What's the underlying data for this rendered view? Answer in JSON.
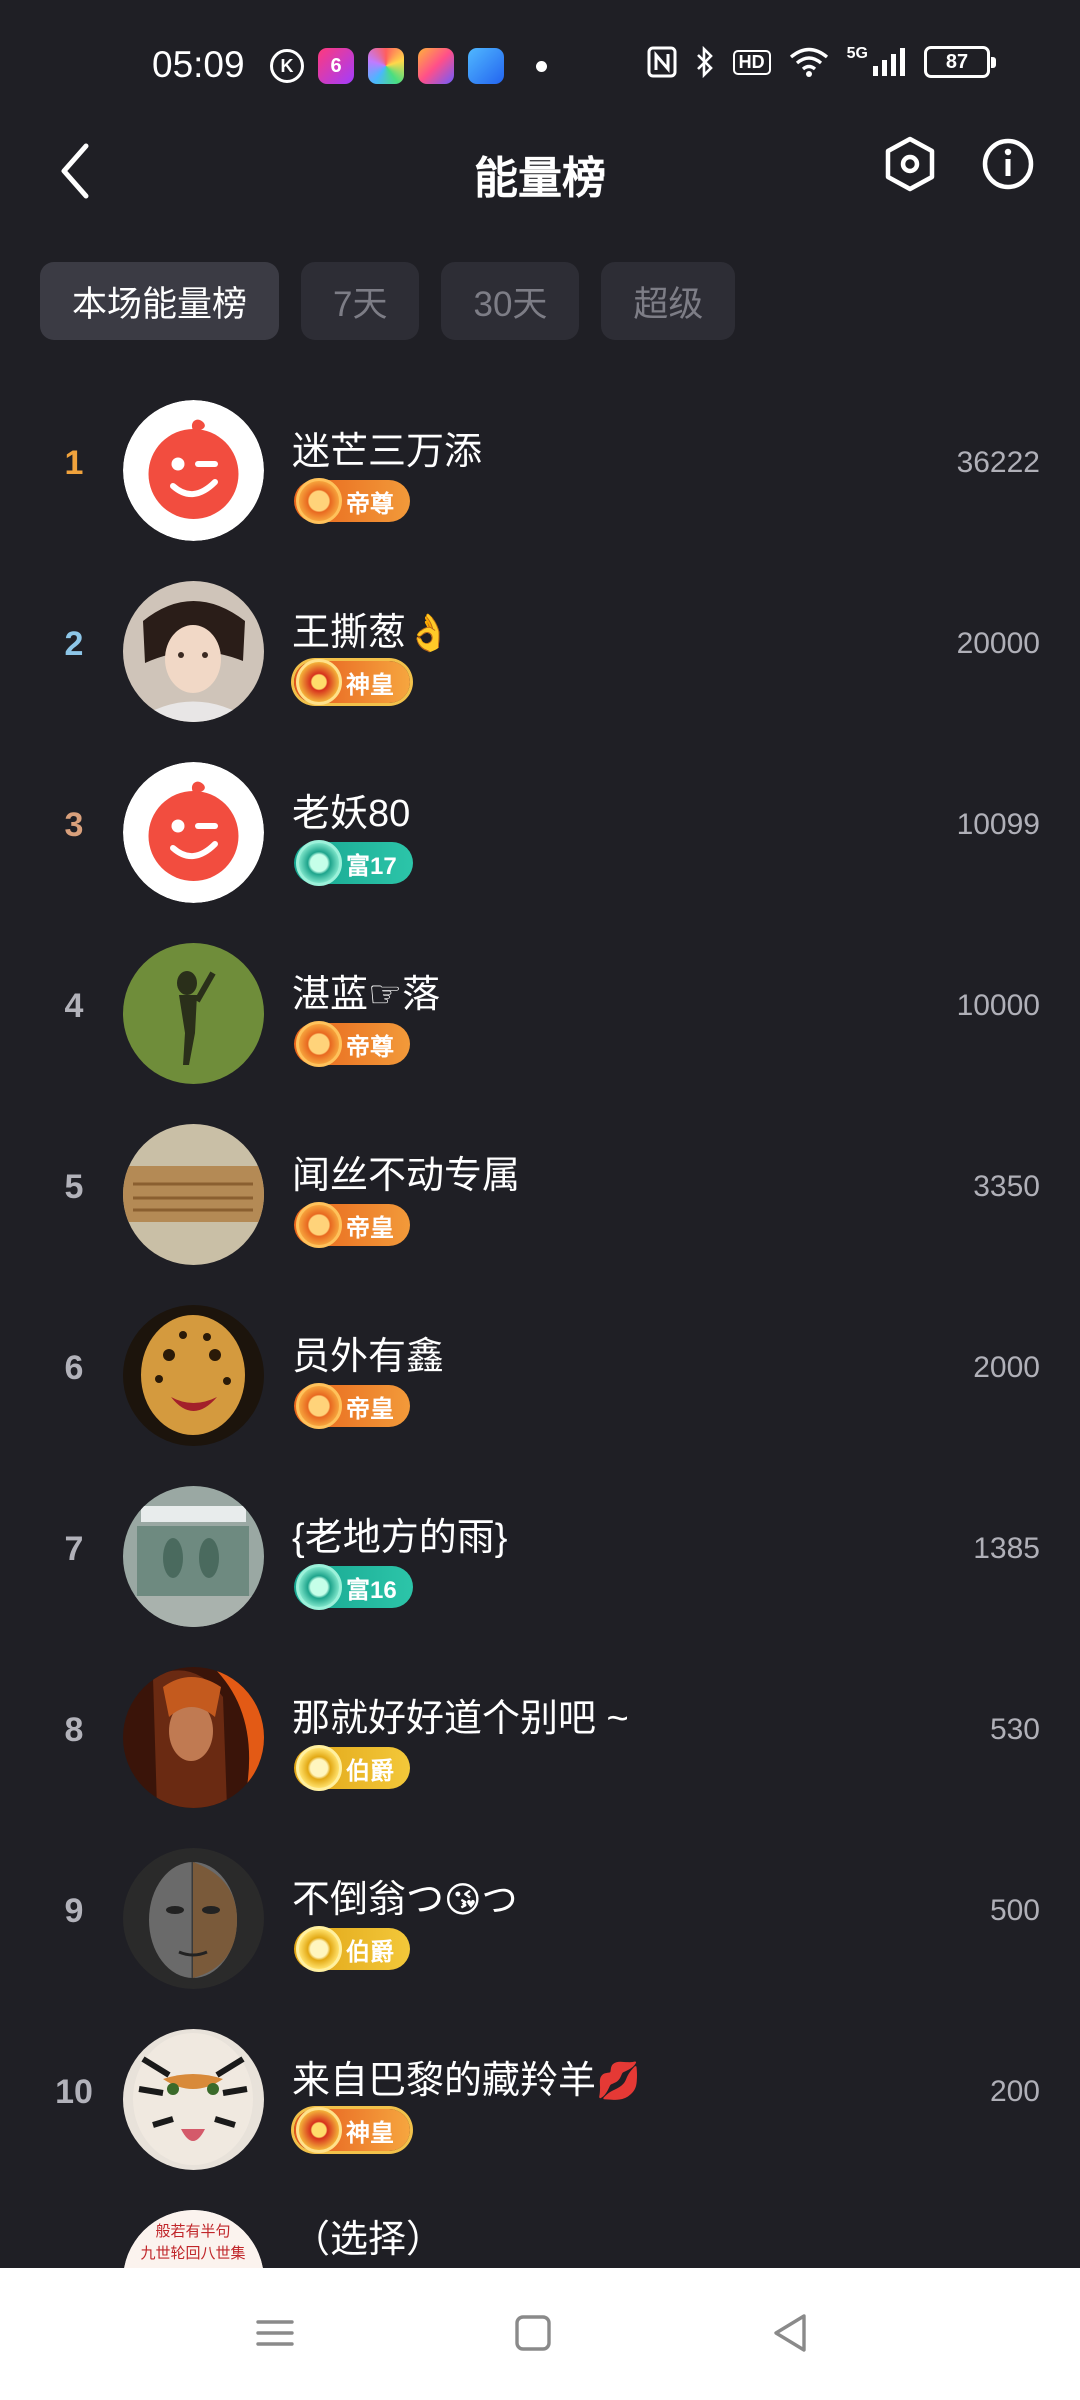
{
  "status": {
    "time": "05:09",
    "apps": [
      {
        "icon": "k-app-icon",
        "glyph": "K",
        "color": "#1f1f25"
      },
      {
        "icon": "app-6-icon",
        "glyph": "6",
        "color": "#e6246b"
      },
      {
        "icon": "app-colorful-icon",
        "glyph": "",
        "color": "#f2f2f2"
      },
      {
        "icon": "app-shortcut-icon",
        "glyph": "",
        "color": "#f08a2b"
      },
      {
        "icon": "app-blue-icon",
        "glyph": "",
        "color": "#2f8cf0"
      }
    ],
    "network": "5G",
    "hd": "HD",
    "battery": "87"
  },
  "header": {
    "title": "能量榜"
  },
  "tabs": [
    {
      "label": "本场能量榜",
      "active": true
    },
    {
      "label": "7天",
      "active": false
    },
    {
      "label": "30天",
      "active": false
    },
    {
      "label": "超级",
      "active": false
    }
  ],
  "rank_colors": {
    "1": "#f0a23c",
    "2": "#8dc6e8",
    "3": "#d9a07c",
    "default": "#b2b2ba"
  },
  "entries": [
    {
      "rank": "1",
      "name": "迷芒三万添",
      "emoji": "",
      "badge": "帝尊",
      "badge_style": "orange",
      "score": "36222",
      "avatar": "default"
    },
    {
      "rank": "2",
      "name": "王撕葱",
      "emoji": "👌",
      "badge": "神皇",
      "badge_style": "wing",
      "score": "20000",
      "avatar": "woman"
    },
    {
      "rank": "3",
      "name": "老妖80",
      "emoji": "",
      "badge": "富17",
      "badge_style": "teal",
      "score": "10099",
      "avatar": "default"
    },
    {
      "rank": "4",
      "name": "湛蓝☞落",
      "emoji": "",
      "badge": "帝尊",
      "badge_style": "orange",
      "score": "10000",
      "avatar": "grass"
    },
    {
      "rank": "5",
      "name": "闻丝不动专属",
      "emoji": "",
      "badge": "帝皇",
      "badge_style": "orange",
      "score": "3350",
      "avatar": "wood"
    },
    {
      "rank": "6",
      "name": "员外有鑫",
      "emoji": "",
      "badge": "帝皇",
      "badge_style": "orange",
      "score": "2000",
      "avatar": "leopard"
    },
    {
      "rank": "7",
      "name": "{老地方的雨}",
      "emoji": "",
      "badge": "富16",
      "badge_style": "teal",
      "score": "1385",
      "avatar": "street"
    },
    {
      "rank": "8",
      "name": "那就好好道个别吧 ~",
      "emoji": "",
      "badge": "伯爵",
      "badge_style": "gold",
      "score": "530",
      "avatar": "fire"
    },
    {
      "rank": "9",
      "name": "不倒翁つ",
      "emoji": "😘つ",
      "badge": "伯爵",
      "badge_style": "gold",
      "score": "500",
      "avatar": "face"
    },
    {
      "rank": "10",
      "name": "来自巴黎的藏羚羊",
      "emoji": "💋",
      "badge": "神皇",
      "badge_style": "wing",
      "score": "200",
      "avatar": "tiger"
    }
  ],
  "partial_entry": {
    "name": "（选择）",
    "avatar_text": "般若有半句 九世轮回八世集"
  },
  "icons": {
    "back": "back-arrow-icon",
    "settings": "hexagon-settings-icon",
    "info": "info-icon",
    "nav_menu": "menu-icon",
    "nav_home": "home-square-icon",
    "nav_back": "back-triangle-icon"
  }
}
